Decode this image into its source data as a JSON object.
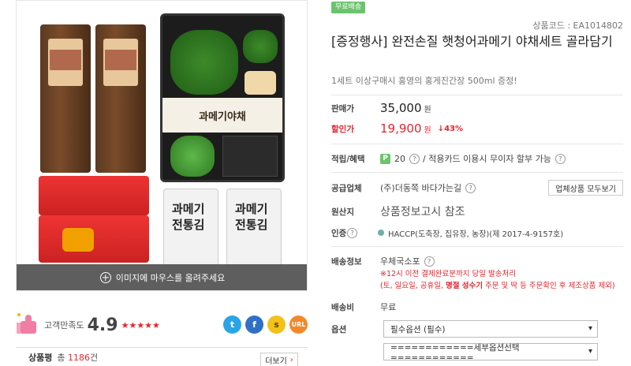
{
  "product_image": {
    "hover_hint": "이미지에 마우스를 올려주세요",
    "band_text": "과메기야채",
    "pack_text_1": "과메기",
    "pack_text_2": "전통김"
  },
  "satisfaction": {
    "label": "고객만족도",
    "score": "4.9",
    "stars": "★★★★★",
    "rating_value": 4.9
  },
  "social": {
    "twitter": "t",
    "facebook": "f",
    "kakaostory": "s",
    "url": "URL"
  },
  "reviews": {
    "label": "상품평",
    "total_prefix": "총",
    "count": "1186",
    "unit": "건",
    "more_label": "더보기"
  },
  "detail": {
    "badge": "무료배송",
    "code": "상품코드 : EA1014802",
    "title": "[증정행사] 완전손질 햇청어과메기 야채세트 골라담기",
    "subtitle": "1세트 이상구매시 홍영의 홍게진간장 500ml 증정!",
    "price_label": "판매가",
    "price": "35,000",
    "won": "원",
    "sale_label": "할인가",
    "sale_price": "19,900",
    "discount": "↓43%",
    "points_label": "적립/혜택",
    "points_icon": "P",
    "points": "20",
    "benefit_text": "/  적용카드 이용시 무이자 할부 가능",
    "vendor_label": "공급업체",
    "vendor": "(주)더동쪽 바다가는길",
    "vendor_button": "업체상품 모두보기",
    "origin_label": "원산지",
    "origin": "상품정보고시 참조",
    "cert_label": "인증",
    "cert": "HACCP(도축장, 집유장, 농장)(제 2017-4-9157호)",
    "ship_info_label": "배송정보",
    "ship_method": "우체국소포",
    "ship_note_1": "※12시 이전 결제완료분까지 당일 발송처리",
    "ship_note_2a": "(토, 일요일, 공휴일, ",
    "ship_note_2b": "명절 성수기",
    "ship_note_2c": " 주문 및 딱 등 주문확인 후 제조상품 제외)",
    "fee_label": "배송비",
    "fee": "무료",
    "option_label": "옵션",
    "option_1": "필수옵션 (필수)",
    "option_2": "============세부옵션선택============",
    "question_mark": "?"
  },
  "colors": {
    "accent_red": "#e4252d",
    "badge_green": "#6cc36e"
  }
}
